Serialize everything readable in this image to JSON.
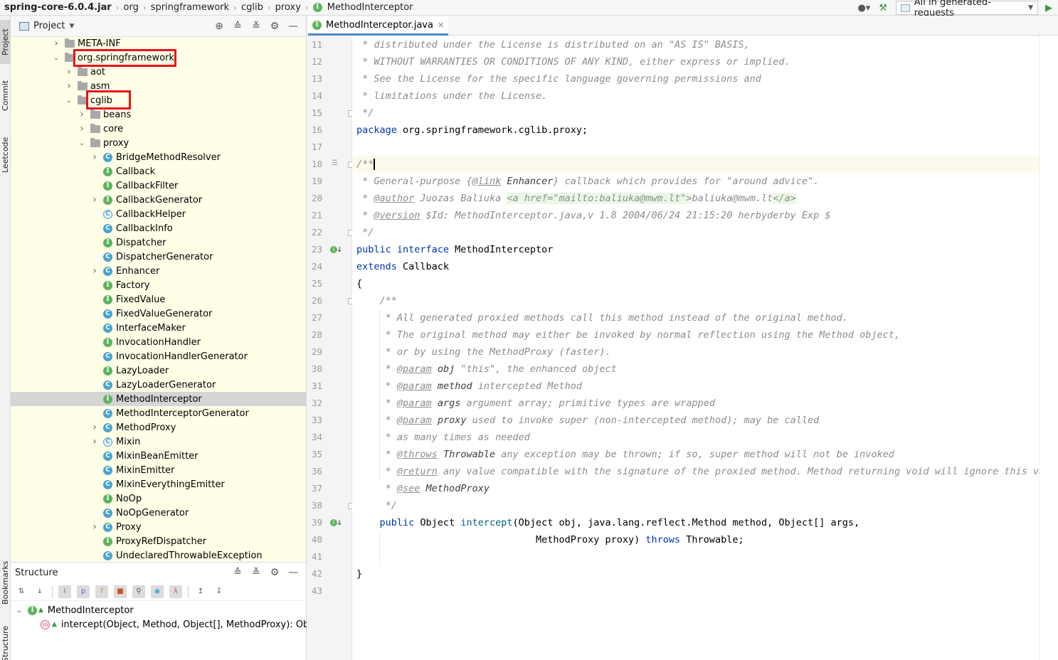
{
  "breadcrumb": {
    "items": [
      "spring-core-6.0.4.jar",
      "org",
      "springframework",
      "cglib",
      "proxy",
      "MethodInterceptor"
    ]
  },
  "toolbar": {
    "run_config": "All in generated-requests"
  },
  "left_strip": {
    "tabs": [
      "Project",
      "Commit",
      "Leetcode",
      "Bookmarks",
      "Structure"
    ]
  },
  "project_panel": {
    "title": "Project",
    "tree": [
      {
        "label": "META-INF",
        "type": "folder",
        "depth": 3,
        "expand": "collapsed"
      },
      {
        "label": "org.springframework",
        "type": "folder",
        "depth": 3,
        "expand": "expanded",
        "highlight": true
      },
      {
        "label": "aot",
        "type": "folder",
        "depth": 4,
        "expand": "collapsed"
      },
      {
        "label": "asm",
        "type": "folder",
        "depth": 4,
        "expand": "collapsed"
      },
      {
        "label": "cglib",
        "type": "folder",
        "depth": 4,
        "expand": "expanded",
        "highlight": true
      },
      {
        "label": "beans",
        "type": "folder",
        "depth": 5,
        "expand": "collapsed"
      },
      {
        "label": "core",
        "type": "folder",
        "depth": 5,
        "expand": "collapsed"
      },
      {
        "label": "proxy",
        "type": "folder",
        "depth": 5,
        "expand": "expanded"
      },
      {
        "label": "BridgeMethodResolver",
        "type": "C",
        "depth": 6,
        "expand": "collapsed"
      },
      {
        "label": "Callback",
        "type": "I",
        "depth": 6,
        "expand": "none"
      },
      {
        "label": "CallbackFilter",
        "type": "I",
        "depth": 6,
        "expand": "none"
      },
      {
        "label": "CallbackGenerator",
        "type": "I",
        "depth": 6,
        "expand": "collapsed"
      },
      {
        "label": "CallbackHelper",
        "type": "CA",
        "depth": 6,
        "expand": "none"
      },
      {
        "label": "CallbackInfo",
        "type": "C",
        "depth": 6,
        "expand": "none"
      },
      {
        "label": "Dispatcher",
        "type": "I",
        "depth": 6,
        "expand": "none"
      },
      {
        "label": "DispatcherGenerator",
        "type": "C",
        "depth": 6,
        "expand": "none"
      },
      {
        "label": "Enhancer",
        "type": "C",
        "depth": 6,
        "expand": "collapsed"
      },
      {
        "label": "Factory",
        "type": "I",
        "depth": 6,
        "expand": "none"
      },
      {
        "label": "FixedValue",
        "type": "I",
        "depth": 6,
        "expand": "none"
      },
      {
        "label": "FixedValueGenerator",
        "type": "C",
        "depth": 6,
        "expand": "none"
      },
      {
        "label": "InterfaceMaker",
        "type": "C",
        "depth": 6,
        "expand": "none"
      },
      {
        "label": "InvocationHandler",
        "type": "I",
        "depth": 6,
        "expand": "none"
      },
      {
        "label": "InvocationHandlerGenerator",
        "type": "C",
        "depth": 6,
        "expand": "none"
      },
      {
        "label": "LazyLoader",
        "type": "I",
        "depth": 6,
        "expand": "none"
      },
      {
        "label": "LazyLoaderGenerator",
        "type": "C",
        "depth": 6,
        "expand": "none"
      },
      {
        "label": "MethodInterceptor",
        "type": "I",
        "depth": 6,
        "expand": "none",
        "selected": true
      },
      {
        "label": "MethodInterceptorGenerator",
        "type": "C",
        "depth": 6,
        "expand": "none"
      },
      {
        "label": "MethodProxy",
        "type": "C",
        "depth": 6,
        "expand": "collapsed"
      },
      {
        "label": "Mixin",
        "type": "CA",
        "depth": 6,
        "expand": "collapsed"
      },
      {
        "label": "MixinBeanEmitter",
        "type": "C",
        "depth": 6,
        "expand": "none"
      },
      {
        "label": "MixinEmitter",
        "type": "C",
        "depth": 6,
        "expand": "none"
      },
      {
        "label": "MixinEverythingEmitter",
        "type": "C",
        "depth": 6,
        "expand": "none"
      },
      {
        "label": "NoOp",
        "type": "I",
        "depth": 6,
        "expand": "none"
      },
      {
        "label": "NoOpGenerator",
        "type": "C",
        "depth": 6,
        "expand": "none"
      },
      {
        "label": "Proxy",
        "type": "C",
        "depth": 6,
        "expand": "collapsed"
      },
      {
        "label": "ProxyRefDispatcher",
        "type": "I",
        "depth": 6,
        "expand": "none"
      },
      {
        "label": "UndeclaredThrowableException",
        "type": "C",
        "depth": 6,
        "expand": "none"
      }
    ]
  },
  "structure_panel": {
    "title": "Structure",
    "root": "MethodInterceptor",
    "member": "intercept(Object, Method, Object[], MethodProxy): Object",
    "toolbar_glyphs": [
      "I",
      "p",
      "f",
      "λ"
    ]
  },
  "editor": {
    "tab_label": "MethodInterceptor.java",
    "lines": [
      {
        "n": "11",
        "tokens": [
          [
            "c",
            " * distributed under the License is distributed on an \"AS IS\" BASIS,"
          ]
        ]
      },
      {
        "n": "12",
        "tokens": [
          [
            "c",
            " * WITHOUT WARRANTIES OR CONDITIONS OF ANY KIND, either express or implied."
          ]
        ]
      },
      {
        "n": "13",
        "tokens": [
          [
            "c",
            " * See the License for the specific language governing permissions and"
          ]
        ]
      },
      {
        "n": "14",
        "tokens": [
          [
            "c",
            " * limitations under the License."
          ]
        ]
      },
      {
        "n": "15",
        "tokens": [
          [
            "c",
            " */"
          ]
        ]
      },
      {
        "n": "16",
        "tokens": [
          [
            "kw",
            "package"
          ],
          [
            "p",
            " org.springframework.cglib.proxy;"
          ]
        ]
      },
      {
        "n": "17",
        "tokens": []
      },
      {
        "n": "18",
        "tokens": [
          [
            "c",
            "/**"
          ],
          [
            "caret",
            ""
          ]
        ],
        "current": true
      },
      {
        "n": "19",
        "tokens": [
          [
            "c",
            " * General-purpose {"
          ],
          [
            "tag",
            "@link"
          ],
          [
            "tagname",
            " Enhancer"
          ],
          [
            "c",
            "} callback which provides for \"around advice\"."
          ]
        ]
      },
      {
        "n": "20",
        "tokens": [
          [
            "c",
            " * "
          ],
          [
            "tag",
            "@author"
          ],
          [
            "c",
            " Juozas Baliuka "
          ],
          [
            "html",
            "<a href=\"mailto:baliuka@mwm.lt\">"
          ],
          [
            "c",
            "baliuka@mwm.lt"
          ],
          [
            "html",
            "</a>"
          ]
        ]
      },
      {
        "n": "21",
        "tokens": [
          [
            "c",
            " * "
          ],
          [
            "tag",
            "@version"
          ],
          [
            "c",
            " $Id: MethodInterceptor.java,v 1.8 2004/06/24 21:15:20 herbyderby Exp $"
          ]
        ]
      },
      {
        "n": "22",
        "tokens": [
          [
            "c",
            " */"
          ]
        ]
      },
      {
        "n": "23",
        "tokens": [
          [
            "kw",
            "public interface"
          ],
          [
            "p",
            " MethodInterceptor"
          ]
        ]
      },
      {
        "n": "24",
        "tokens": [
          [
            "kw",
            "extends"
          ],
          [
            "p",
            " Callback"
          ]
        ]
      },
      {
        "n": "25",
        "tokens": [
          [
            "p",
            "{"
          ]
        ]
      },
      {
        "n": "26",
        "tokens": [
          [
            "c",
            "    /**"
          ]
        ]
      },
      {
        "n": "27",
        "tokens": [
          [
            "c",
            "     * All generated proxied methods call this method instead of the original method."
          ]
        ]
      },
      {
        "n": "28",
        "tokens": [
          [
            "c",
            "     * The original method may either be invoked by normal reflection using the Method object,"
          ]
        ]
      },
      {
        "n": "29",
        "tokens": [
          [
            "c",
            "     * or by using the MethodProxy (faster)."
          ]
        ]
      },
      {
        "n": "30",
        "tokens": [
          [
            "c",
            "     * "
          ],
          [
            "tag",
            "@param"
          ],
          [
            "tagname",
            " obj"
          ],
          [
            "c",
            " \"this\", the enhanced object"
          ]
        ]
      },
      {
        "n": "31",
        "tokens": [
          [
            "c",
            "     * "
          ],
          [
            "tag",
            "@param"
          ],
          [
            "tagname",
            " method"
          ],
          [
            "c",
            " intercepted Method"
          ]
        ]
      },
      {
        "n": "32",
        "tokens": [
          [
            "c",
            "     * "
          ],
          [
            "tag",
            "@param"
          ],
          [
            "tagname",
            " args"
          ],
          [
            "c",
            " argument array; primitive types are wrapped"
          ]
        ]
      },
      {
        "n": "33",
        "tokens": [
          [
            "c",
            "     * "
          ],
          [
            "tag",
            "@param"
          ],
          [
            "tagname",
            " proxy"
          ],
          [
            "c",
            " used to invoke super (non-intercepted method); may be called"
          ]
        ]
      },
      {
        "n": "34",
        "tokens": [
          [
            "c",
            "     * as many times as needed"
          ]
        ]
      },
      {
        "n": "35",
        "tokens": [
          [
            "c",
            "     * "
          ],
          [
            "tag",
            "@throws"
          ],
          [
            "tagname",
            " Throwable"
          ],
          [
            "c",
            " any exception may be thrown; if so, super method will not be invoked"
          ]
        ]
      },
      {
        "n": "36",
        "tokens": [
          [
            "c",
            "     * "
          ],
          [
            "tag",
            "@return"
          ],
          [
            "c",
            " any value compatible with the signature of the proxied method. Method returning void will ignore this value."
          ]
        ]
      },
      {
        "n": "37",
        "tokens": [
          [
            "c",
            "     * "
          ],
          [
            "tag",
            "@see"
          ],
          [
            "tagname",
            " MethodProxy"
          ]
        ]
      },
      {
        "n": "38",
        "tokens": [
          [
            "c",
            "     */"
          ]
        ]
      },
      {
        "n": "39",
        "tokens": [
          [
            "p",
            "    "
          ],
          [
            "kw",
            "public"
          ],
          [
            "p",
            " Object "
          ],
          [
            "fn",
            "intercept"
          ],
          [
            "p",
            "(Object obj, java.lang.reflect.Method method, Object[] args,"
          ]
        ]
      },
      {
        "n": "40",
        "tokens": [
          [
            "p",
            "                               MethodProxy proxy) "
          ],
          [
            "kw",
            "throws"
          ],
          [
            "p",
            " Throwable;"
          ]
        ]
      },
      {
        "n": "41",
        "tokens": []
      },
      {
        "n": "42",
        "tokens": [
          [
            "p",
            "}"
          ]
        ]
      },
      {
        "n": "43",
        "tokens": []
      }
    ]
  }
}
